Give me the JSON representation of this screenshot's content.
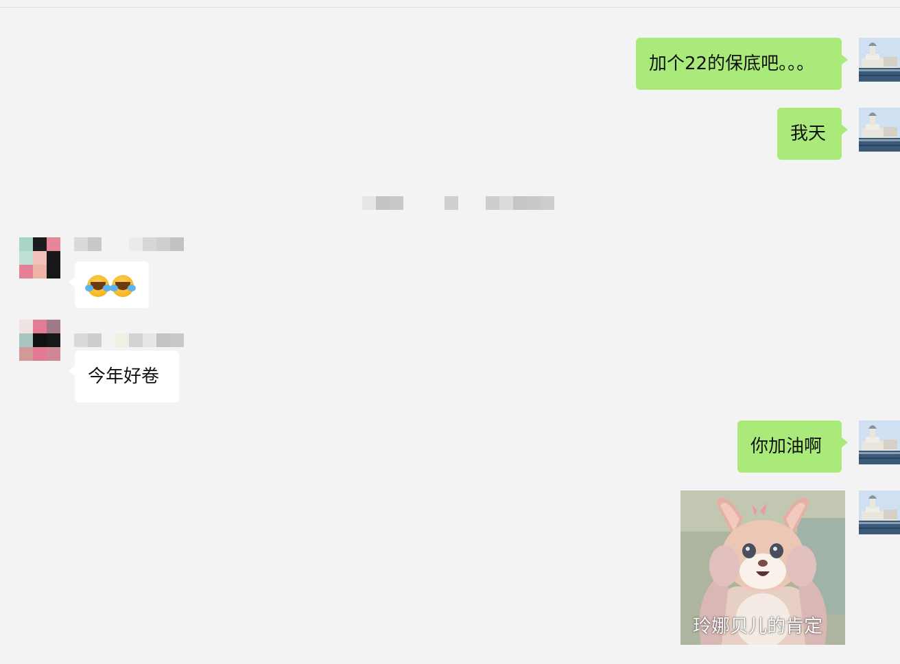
{
  "chat": {
    "messages": [
      {
        "sender": "self",
        "text": "加个22的保底吧。。。"
      },
      {
        "sender": "self",
        "text": "我天"
      },
      {
        "sender": "other",
        "text": "",
        "content": "two crying-laughing emoji"
      },
      {
        "sender": "other",
        "text": "今年好卷"
      },
      {
        "sender": "self",
        "text": "你加油啊"
      },
      {
        "sender": "self",
        "sticker_caption": "玲娜贝儿的肯定"
      }
    ]
  },
  "icons": {
    "emoji": "face-with-tears-of-joy-icon"
  },
  "colors": {
    "background": "#f3f3f3",
    "self_bubble": "#a9ea7a",
    "other_bubble": "#ffffff"
  }
}
